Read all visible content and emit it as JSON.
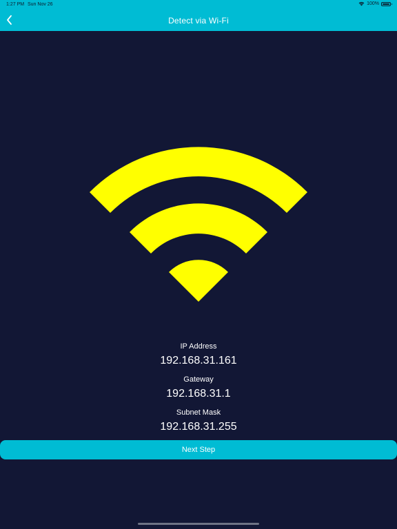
{
  "status_bar": {
    "time": "1:27 PM",
    "date": "Sun Nov 26",
    "battery": "100%",
    "battery_level_percent": 100
  },
  "nav": {
    "back_icon": "chevron-left-icon",
    "title": "Detect via Wi-Fi"
  },
  "wifi_icon": {
    "name": "wifi-icon",
    "color": "#ffff00"
  },
  "network": {
    "ip_label": "IP Address",
    "ip_value": "192.168.31.161",
    "gateway_label": "Gateway",
    "gateway_value": "192.168.31.1",
    "subnet_label": "Subnet Mask",
    "subnet_value": "192.168.31.255"
  },
  "actions": {
    "next_label": "Next Step"
  },
  "colors": {
    "background": "#121735",
    "accent": "#00bcd4",
    "wifi": "#ffff00",
    "text": "#ffffff"
  }
}
